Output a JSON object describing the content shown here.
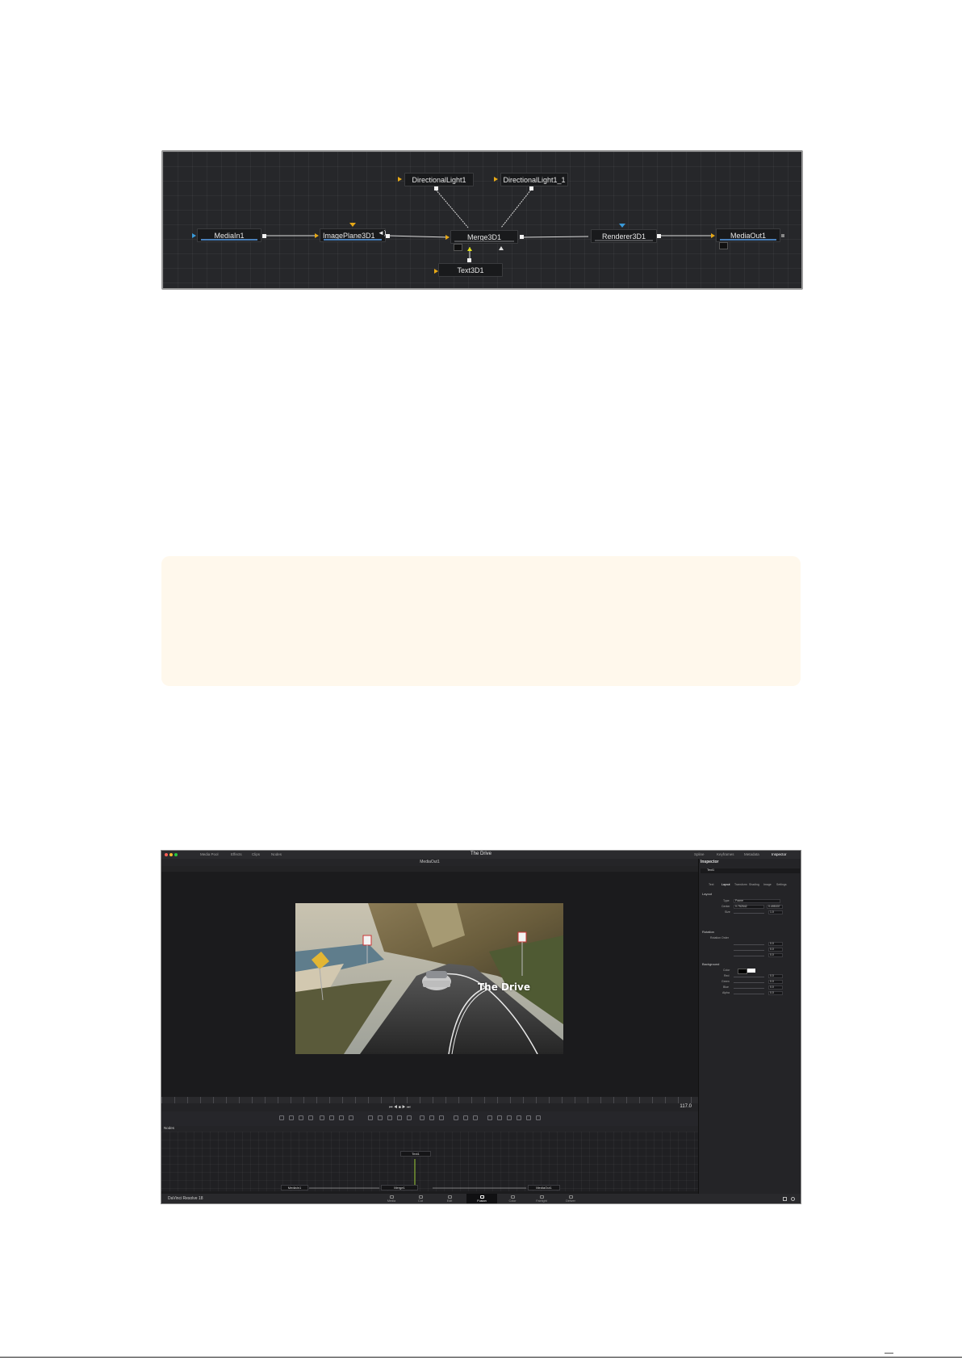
{
  "node_graph": {
    "nodes": {
      "directional_light_1": "DirectionalLight1",
      "directional_light_1_1": "DirectionalLight1_1",
      "media_in": "MediaIn1",
      "image_plane": "ImagePlane3D1",
      "merge": "Merge3D1",
      "renderer": "Renderer3D1",
      "media_out": "MediaOut1",
      "text3d": "Text3D1"
    },
    "colors": {
      "background": "#26272a",
      "input_arrow": "#e6a817",
      "blue_arrow": "#3a9ad9",
      "node_bar": "#4a7fb8"
    }
  },
  "note_box": {
    "background": "#fff8ec"
  },
  "fusion_screenshot": {
    "window_title": "The Drive",
    "toolbar_left": [
      "Media Pool",
      "Effects",
      "Clips",
      "Nodes"
    ],
    "toolbar_right": [
      "Spline",
      "Keyframes",
      "Metadata",
      "Inspector"
    ],
    "viewer_name": "MediaOut1",
    "video_overlay_title": "The Drive",
    "current_frame": "117.0",
    "nodes_panel_label": "Nodes",
    "nodes": {
      "text": "Text1",
      "media_in": "MediaIn1",
      "merge": "Merge1",
      "media_out": "MediaOut1"
    },
    "inspector": {
      "title": "Inspector",
      "tool_name": "Text1",
      "tabs": [
        "Text",
        "Layout",
        "Transform",
        "Shading",
        "Image",
        "Settings"
      ],
      "sections": [
        "Layout",
        "Rotation",
        "Background"
      ],
      "fields": {
        "type_label": "Type",
        "type_value": "Frame",
        "center_label": "Center",
        "center_x": "0.752542",
        "center_y": "0.495337",
        "size_label": "Size",
        "size_value": "1.0",
        "rotation_order_label": "Rotation Order",
        "color_label": "Color",
        "red_label": "Red",
        "green_label": "Green",
        "blue_label": "Blue",
        "alpha_label": "Alpha",
        "zero": "0.0"
      }
    },
    "pages": [
      "Media",
      "Cut",
      "Edit",
      "Fusion",
      "Color",
      "Fairlight",
      "Deliver"
    ],
    "active_page": "Fusion",
    "brand": "DaVinci Resolve 18"
  }
}
